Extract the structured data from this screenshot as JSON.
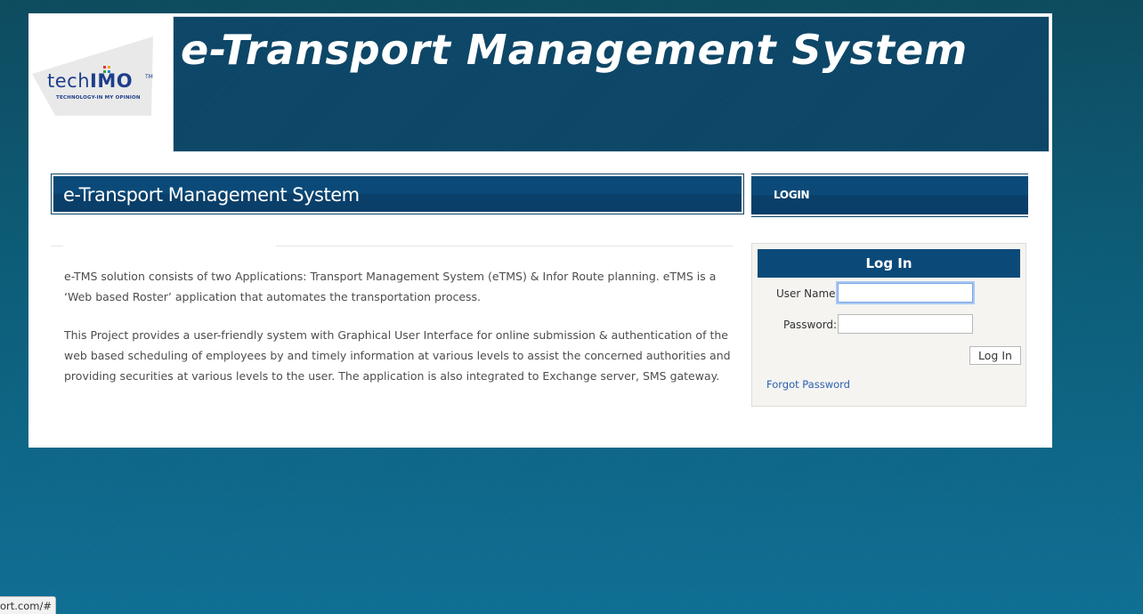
{
  "logo": {
    "word_prefix": "tech",
    "word_suffix": "IMO",
    "trademark": "TM",
    "tagline": "TECHNOLOGY-IN MY OPINION",
    "dot_colors": [
      "#e8332a",
      "#f5a623",
      "#3a9d3a",
      "#1e88c8"
    ]
  },
  "banner": {
    "title": "e-Transport Management System",
    "background_color": "#0b4566"
  },
  "section_heading": {
    "title": "e-Transport Management System"
  },
  "login_tab": {
    "label": "LOGIN"
  },
  "content": {
    "paragraphs": [
      "e-TMS solution consists of two Applications: Transport Management System (eTMS) & Infor Route planning. eTMS is a ‘Web based Roster’ application that automates the transportation process.",
      "This Project provides a user-friendly system with Graphical User Interface for online submission & authentication of the web based scheduling of employees by and timely information at various levels to assist the concerned authorities and providing securities at various levels to the user. The application is also integrated to Exchange server, SMS gateway."
    ]
  },
  "login": {
    "title": "Log In",
    "username_label": "User Name:",
    "username_value": "",
    "password_label": "Password:",
    "password_value": "",
    "submit_label": "Log In",
    "forgot_label": "Forgot Password"
  },
  "status_bar": {
    "url": "ort.com/#"
  }
}
